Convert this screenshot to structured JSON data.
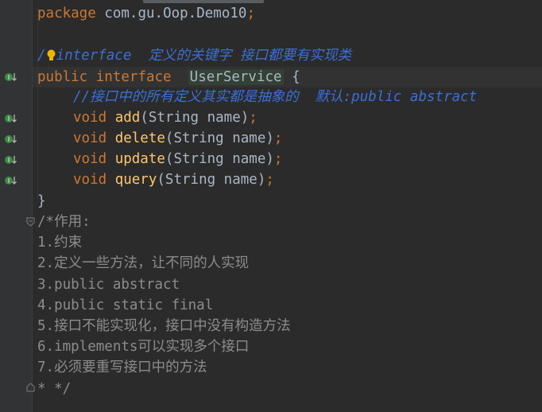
{
  "editor": {
    "lines": {
      "package_kw": "package",
      "package_name": "com.gu.Oop.Demo10",
      "semicolon": ";",
      "comment1_slash": "/",
      "comment1_rest": "interface  定义的关键字 接口都要有实现类",
      "public_kw": "public",
      "interface_kw": "interface",
      "class_name": "UserService",
      "open_brace": " {",
      "comment2": "//接口中的所有定义其实都是抽象的  默认:public abstract",
      "void_kw": "void",
      "methods": [
        {
          "name": "add",
          "params": "(String name)"
        },
        {
          "name": "delete",
          "params": "(String name)"
        },
        {
          "name": "update",
          "params": "(String name)"
        },
        {
          "name": "query",
          "params": "(String name)"
        }
      ],
      "close_brace": "}",
      "block_comment": [
        "/*作用:",
        "1.约束",
        "2.定义一些方法，让不同的人实现",
        "3.public abstract",
        "4.public static final",
        "5.接口不能实现化，接口中没有构造方法",
        "6.implements可以实现多个接口",
        "7.必须要重写接口中的方法",
        "* */"
      ]
    },
    "gutter_icons": [
      "implemented-method-icon"
    ],
    "colors": {
      "background": "#2b2b2b",
      "keyword": "#cc7832",
      "method": "#ffc66d",
      "comment_doc": "#3a6fd6",
      "comment_block": "#8c8c8c",
      "text": "#a9b7c6"
    }
  }
}
